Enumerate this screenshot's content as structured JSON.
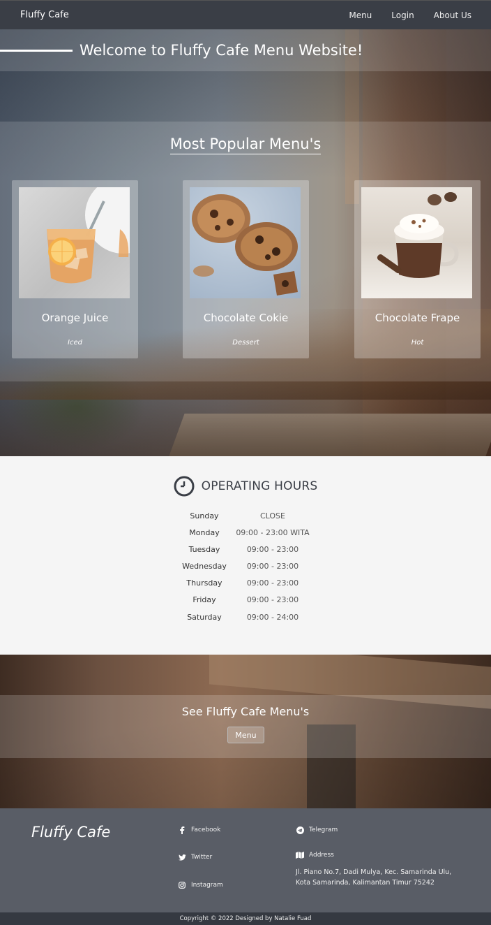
{
  "navbar": {
    "brand": "Fluffy Cafe",
    "links": [
      "Menu",
      "Login",
      "About Us"
    ]
  },
  "hero": {
    "welcome": "Welcome to Fluffy Cafe Menu Website!",
    "popular_title": "Most Popular Menu's",
    "cards": [
      {
        "name": "Orange Juice",
        "category": "Iced"
      },
      {
        "name": "Chocolate Cokie",
        "category": "Dessert"
      },
      {
        "name": "Chocolate Frape",
        "category": "Hot"
      }
    ]
  },
  "hours": {
    "title": "OPERATING HOURS",
    "rows": [
      {
        "day": "Sunday",
        "time": "CLOSE"
      },
      {
        "day": "Monday",
        "time": "09:00 - 23:00 WITA"
      },
      {
        "day": "Tuesday",
        "time": "09:00 - 23:00"
      },
      {
        "day": "Wednesday",
        "time": "09:00 - 23:00"
      },
      {
        "day": "Thursday",
        "time": "09:00 - 23:00"
      },
      {
        "day": "Friday",
        "time": "09:00 - 23:00"
      },
      {
        "day": "Saturday",
        "time": "09:00 - 24:00"
      }
    ]
  },
  "cta": {
    "title": "See Fluffy Cafe Menu's",
    "button": "Menu"
  },
  "footer": {
    "brand": "Fluffy Cafe",
    "facebook": "Facebook",
    "twitter": "Twitter",
    "instagram": "Instagram",
    "telegram": "Telegram",
    "address_label": "Address",
    "address_line1": "Jl. Piano No.7, Dadi Mulya, Kec. Samarinda Ulu,",
    "address_line2": "Kota Samarinda, Kalimantan Timur 75242",
    "copyright": "Copyright © 2022 Designed by Natalie Fuad"
  },
  "colors": {
    "navbar": "#3a3e46",
    "footer": "#595d66",
    "copyright_bar": "#353941",
    "hours_bg": "#f5f5f5"
  }
}
